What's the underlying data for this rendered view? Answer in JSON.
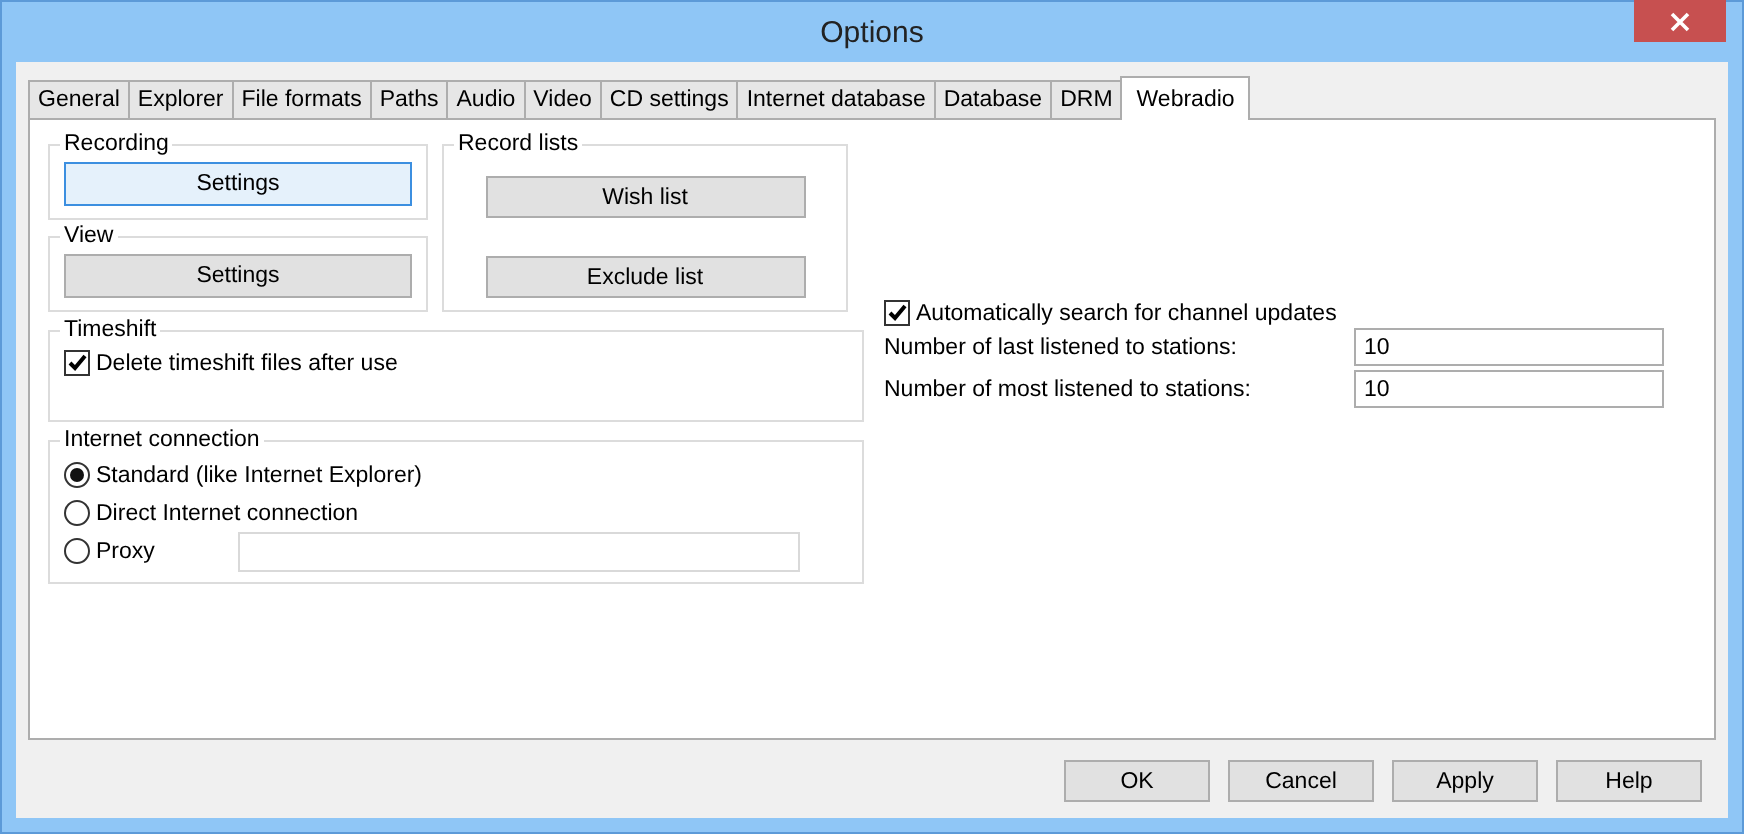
{
  "window": {
    "title": "Options"
  },
  "tabs": [
    {
      "label": "General",
      "selected": false
    },
    {
      "label": "Explorer",
      "selected": false
    },
    {
      "label": "File formats",
      "selected": false
    },
    {
      "label": "Paths",
      "selected": false
    },
    {
      "label": "Audio",
      "selected": false
    },
    {
      "label": "Video",
      "selected": false
    },
    {
      "label": "CD settings",
      "selected": false
    },
    {
      "label": "Internet database",
      "selected": false
    },
    {
      "label": "Database",
      "selected": false
    },
    {
      "label": "DRM",
      "selected": false
    },
    {
      "label": "Webradio",
      "selected": true
    }
  ],
  "recording": {
    "title": "Recording",
    "button": {
      "label": "Settings",
      "focused": true
    }
  },
  "view": {
    "title": "View",
    "button": {
      "label": "Settings",
      "focused": false
    }
  },
  "record_lists": {
    "title": "Record lists",
    "buttons": [
      {
        "label": "Wish list"
      },
      {
        "label": "Exclude list"
      }
    ]
  },
  "timeshift": {
    "title": "Timeshift",
    "checkbox": {
      "label": "Delete timeshift files after use",
      "checked": true
    }
  },
  "internet_connection": {
    "title": "Internet connection",
    "options": [
      {
        "label": "Standard (like Internet Explorer)",
        "selected": true
      },
      {
        "label": "Direct Internet connection",
        "selected": false
      },
      {
        "label": "Proxy",
        "selected": false
      }
    ]
  },
  "auto_search": {
    "label": "Automatically search for channel updates",
    "checked": true
  },
  "fields": [
    {
      "label": "Number of last listened to stations:",
      "value": "10"
    },
    {
      "label": "Number of most listened to stations:",
      "value": "10"
    }
  ],
  "buttons": [
    {
      "label": "OK"
    },
    {
      "label": "Cancel"
    },
    {
      "label": "Apply"
    },
    {
      "label": "Help"
    }
  ]
}
